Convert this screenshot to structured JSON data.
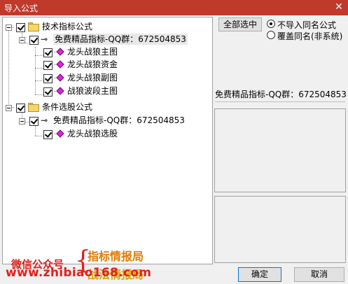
{
  "window": {
    "title": "导入公式",
    "close_glyph": "✕"
  },
  "tree": {
    "root1": {
      "label": "技术指标公式"
    },
    "root1_child": {
      "label": "免费精品指标-QQ群：672504853"
    },
    "items1": [
      {
        "label": "龙头战狼主图"
      },
      {
        "label": "龙头战狼资金"
      },
      {
        "label": "龙头战狼副图"
      },
      {
        "label": "战狼波段主图"
      }
    ],
    "root2": {
      "label": "条件选股公式"
    },
    "root2_child": {
      "label": "免费精品指标-QQ群：672504853"
    },
    "items2": [
      {
        "label": "龙头战狼选股"
      }
    ],
    "icons": {
      "folder": "folder-icon",
      "key": "key-icon",
      "formula": "formula-icon"
    }
  },
  "right": {
    "select_all_label": "全部选中",
    "radio_skip_label": "不导入同名公式",
    "radio_overwrite_label": "覆盖同名(非系统)",
    "selected_name": "免费精品指标-QQ群：672504853"
  },
  "watermark": {
    "wechat": "微信公众号",
    "brace": "{",
    "line1": "指标情报局",
    "line2": "战法情报局",
    "url": "www.zhibiao168.com"
  },
  "buttons": {
    "ok": "确定",
    "cancel": "取消"
  },
  "colors": {
    "titlebar": "#c0392b",
    "watermark_red": "#e0201d",
    "watermark_orange": "#e07b00"
  }
}
